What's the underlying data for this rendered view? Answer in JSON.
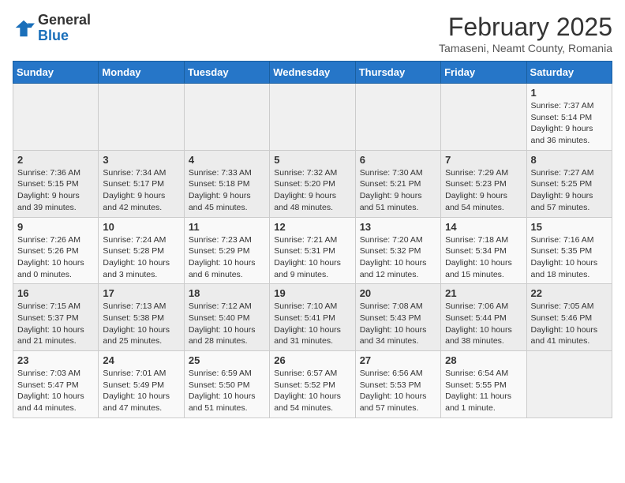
{
  "logo": {
    "general": "General",
    "blue": "Blue"
  },
  "title": "February 2025",
  "subtitle": "Tamaseni, Neamt County, Romania",
  "days_of_week": [
    "Sunday",
    "Monday",
    "Tuesday",
    "Wednesday",
    "Thursday",
    "Friday",
    "Saturday"
  ],
  "weeks": [
    [
      {
        "day": "",
        "info": ""
      },
      {
        "day": "",
        "info": ""
      },
      {
        "day": "",
        "info": ""
      },
      {
        "day": "",
        "info": ""
      },
      {
        "day": "",
        "info": ""
      },
      {
        "day": "",
        "info": ""
      },
      {
        "day": "1",
        "info": "Sunrise: 7:37 AM\nSunset: 5:14 PM\nDaylight: 9 hours and 36 minutes."
      }
    ],
    [
      {
        "day": "2",
        "info": "Sunrise: 7:36 AM\nSunset: 5:15 PM\nDaylight: 9 hours and 39 minutes."
      },
      {
        "day": "3",
        "info": "Sunrise: 7:34 AM\nSunset: 5:17 PM\nDaylight: 9 hours and 42 minutes."
      },
      {
        "day": "4",
        "info": "Sunrise: 7:33 AM\nSunset: 5:18 PM\nDaylight: 9 hours and 45 minutes."
      },
      {
        "day": "5",
        "info": "Sunrise: 7:32 AM\nSunset: 5:20 PM\nDaylight: 9 hours and 48 minutes."
      },
      {
        "day": "6",
        "info": "Sunrise: 7:30 AM\nSunset: 5:21 PM\nDaylight: 9 hours and 51 minutes."
      },
      {
        "day": "7",
        "info": "Sunrise: 7:29 AM\nSunset: 5:23 PM\nDaylight: 9 hours and 54 minutes."
      },
      {
        "day": "8",
        "info": "Sunrise: 7:27 AM\nSunset: 5:25 PM\nDaylight: 9 hours and 57 minutes."
      }
    ],
    [
      {
        "day": "9",
        "info": "Sunrise: 7:26 AM\nSunset: 5:26 PM\nDaylight: 10 hours and 0 minutes."
      },
      {
        "day": "10",
        "info": "Sunrise: 7:24 AM\nSunset: 5:28 PM\nDaylight: 10 hours and 3 minutes."
      },
      {
        "day": "11",
        "info": "Sunrise: 7:23 AM\nSunset: 5:29 PM\nDaylight: 10 hours and 6 minutes."
      },
      {
        "day": "12",
        "info": "Sunrise: 7:21 AM\nSunset: 5:31 PM\nDaylight: 10 hours and 9 minutes."
      },
      {
        "day": "13",
        "info": "Sunrise: 7:20 AM\nSunset: 5:32 PM\nDaylight: 10 hours and 12 minutes."
      },
      {
        "day": "14",
        "info": "Sunrise: 7:18 AM\nSunset: 5:34 PM\nDaylight: 10 hours and 15 minutes."
      },
      {
        "day": "15",
        "info": "Sunrise: 7:16 AM\nSunset: 5:35 PM\nDaylight: 10 hours and 18 minutes."
      }
    ],
    [
      {
        "day": "16",
        "info": "Sunrise: 7:15 AM\nSunset: 5:37 PM\nDaylight: 10 hours and 21 minutes."
      },
      {
        "day": "17",
        "info": "Sunrise: 7:13 AM\nSunset: 5:38 PM\nDaylight: 10 hours and 25 minutes."
      },
      {
        "day": "18",
        "info": "Sunrise: 7:12 AM\nSunset: 5:40 PM\nDaylight: 10 hours and 28 minutes."
      },
      {
        "day": "19",
        "info": "Sunrise: 7:10 AM\nSunset: 5:41 PM\nDaylight: 10 hours and 31 minutes."
      },
      {
        "day": "20",
        "info": "Sunrise: 7:08 AM\nSunset: 5:43 PM\nDaylight: 10 hours and 34 minutes."
      },
      {
        "day": "21",
        "info": "Sunrise: 7:06 AM\nSunset: 5:44 PM\nDaylight: 10 hours and 38 minutes."
      },
      {
        "day": "22",
        "info": "Sunrise: 7:05 AM\nSunset: 5:46 PM\nDaylight: 10 hours and 41 minutes."
      }
    ],
    [
      {
        "day": "23",
        "info": "Sunrise: 7:03 AM\nSunset: 5:47 PM\nDaylight: 10 hours and 44 minutes."
      },
      {
        "day": "24",
        "info": "Sunrise: 7:01 AM\nSunset: 5:49 PM\nDaylight: 10 hours and 47 minutes."
      },
      {
        "day": "25",
        "info": "Sunrise: 6:59 AM\nSunset: 5:50 PM\nDaylight: 10 hours and 51 minutes."
      },
      {
        "day": "26",
        "info": "Sunrise: 6:57 AM\nSunset: 5:52 PM\nDaylight: 10 hours and 54 minutes."
      },
      {
        "day": "27",
        "info": "Sunrise: 6:56 AM\nSunset: 5:53 PM\nDaylight: 10 hours and 57 minutes."
      },
      {
        "day": "28",
        "info": "Sunrise: 6:54 AM\nSunset: 5:55 PM\nDaylight: 11 hours and 1 minute."
      },
      {
        "day": "",
        "info": ""
      }
    ]
  ]
}
